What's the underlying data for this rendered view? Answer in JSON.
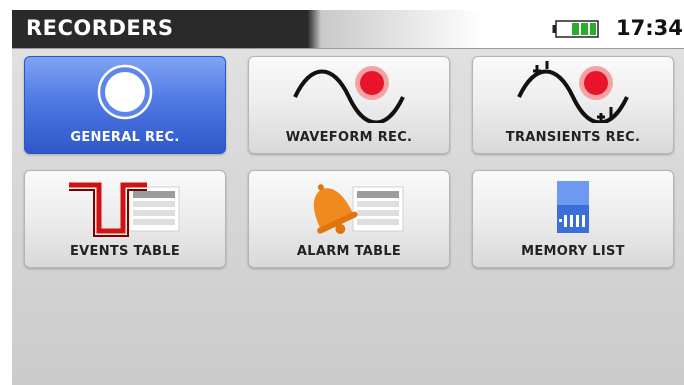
{
  "header": {
    "title": "RECORDERS",
    "time": "17:34",
    "battery_icon": "battery-icon"
  },
  "tiles": [
    {
      "label": "GENERAL REC.",
      "icon": "record-circle-icon",
      "selected": true
    },
    {
      "label": "WAVEFORM REC.",
      "icon": "waveform-record-icon"
    },
    {
      "label": "TRANSIENTS REC.",
      "icon": "transients-record-icon"
    },
    {
      "label": "EVENTS TABLE",
      "icon": "events-table-icon"
    },
    {
      "label": "ALARM TABLE",
      "icon": "alarm-bell-table-icon"
    },
    {
      "label": "MEMORY LIST",
      "icon": "memory-card-icon"
    }
  ],
  "colors": {
    "accent": "#4f79e4",
    "record_red": "#e8152a",
    "alarm_orange": "#f08a1e",
    "sd_blue": "#3a6fd8"
  }
}
